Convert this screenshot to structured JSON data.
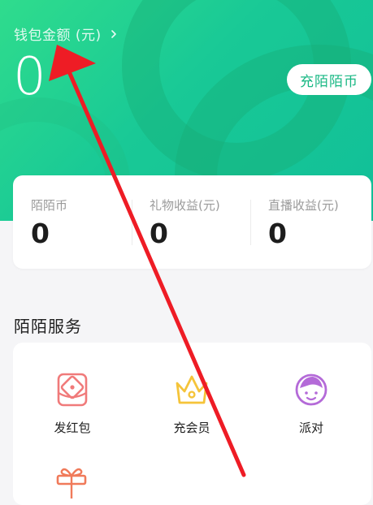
{
  "wallet": {
    "label": "钱包金额 (元)",
    "amount": "0",
    "recharge_label": "充陌陌币"
  },
  "stats": [
    {
      "label": "陌陌币",
      "value": "0"
    },
    {
      "label": "礼物收益(元)",
      "value": "0"
    },
    {
      "label": "直播收益(元)",
      "value": "0"
    }
  ],
  "services": {
    "title": "陌陌服务",
    "items": [
      {
        "label": "发红包",
        "icon": "red-envelope-icon"
      },
      {
        "label": "充会员",
        "icon": "crown-icon"
      },
      {
        "label": "派对",
        "icon": "party-face-icon"
      }
    ],
    "partial_icon": "gift-icon"
  },
  "colors": {
    "hero_green": "#19c996",
    "recharge_text": "#19b884",
    "red_envelope": "#f07a7a",
    "crown": "#f5c43a",
    "party": "#b46ad8",
    "annotation_arrow": "#ee1c25"
  }
}
